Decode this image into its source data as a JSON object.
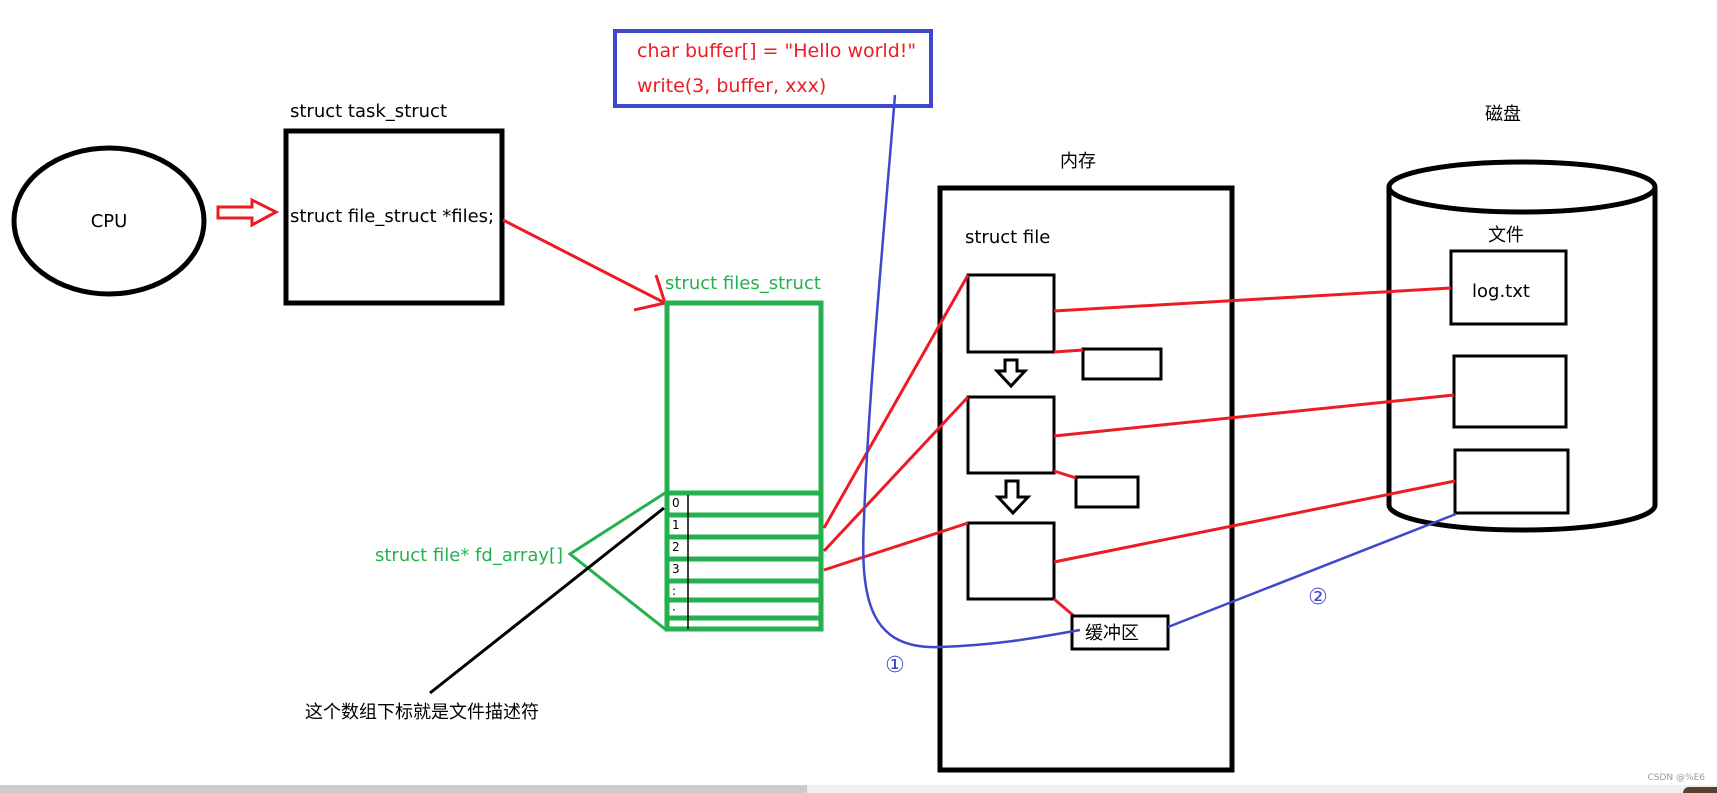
{
  "diagram": {
    "cpu": {
      "label": "CPU"
    },
    "task_struct": {
      "title": "struct task_struct",
      "field": "struct file_struct *files;"
    },
    "files_struct": {
      "title": "struct files_struct",
      "fd_array_label": "struct file* fd_array[]",
      "indices": [
        "0",
        "1",
        "2",
        "3",
        ":",
        "·",
        ""
      ]
    },
    "annotation": {
      "text": "这个数组下标就是文件描述符"
    },
    "code_box": {
      "lines": [
        "char buffer[] = \"Hello world!\"",
        "write(3, buffer, xxx)"
      ]
    },
    "memory": {
      "title": "内存",
      "struct_file_label": "struct file",
      "buffer_label": "缓冲区"
    },
    "disk": {
      "title": "磁盘",
      "files_label": "文件",
      "files": [
        "log.txt",
        "",
        ""
      ]
    },
    "steps": [
      "①",
      "②"
    ],
    "colors": {
      "red": "#ed1c24",
      "green": "#22b14c",
      "blue": "#3f48cc",
      "black": "#000000"
    }
  },
  "watermark": "CSDN @%E6",
  "scrollbar": {
    "thumb_fraction": 0.47
  }
}
